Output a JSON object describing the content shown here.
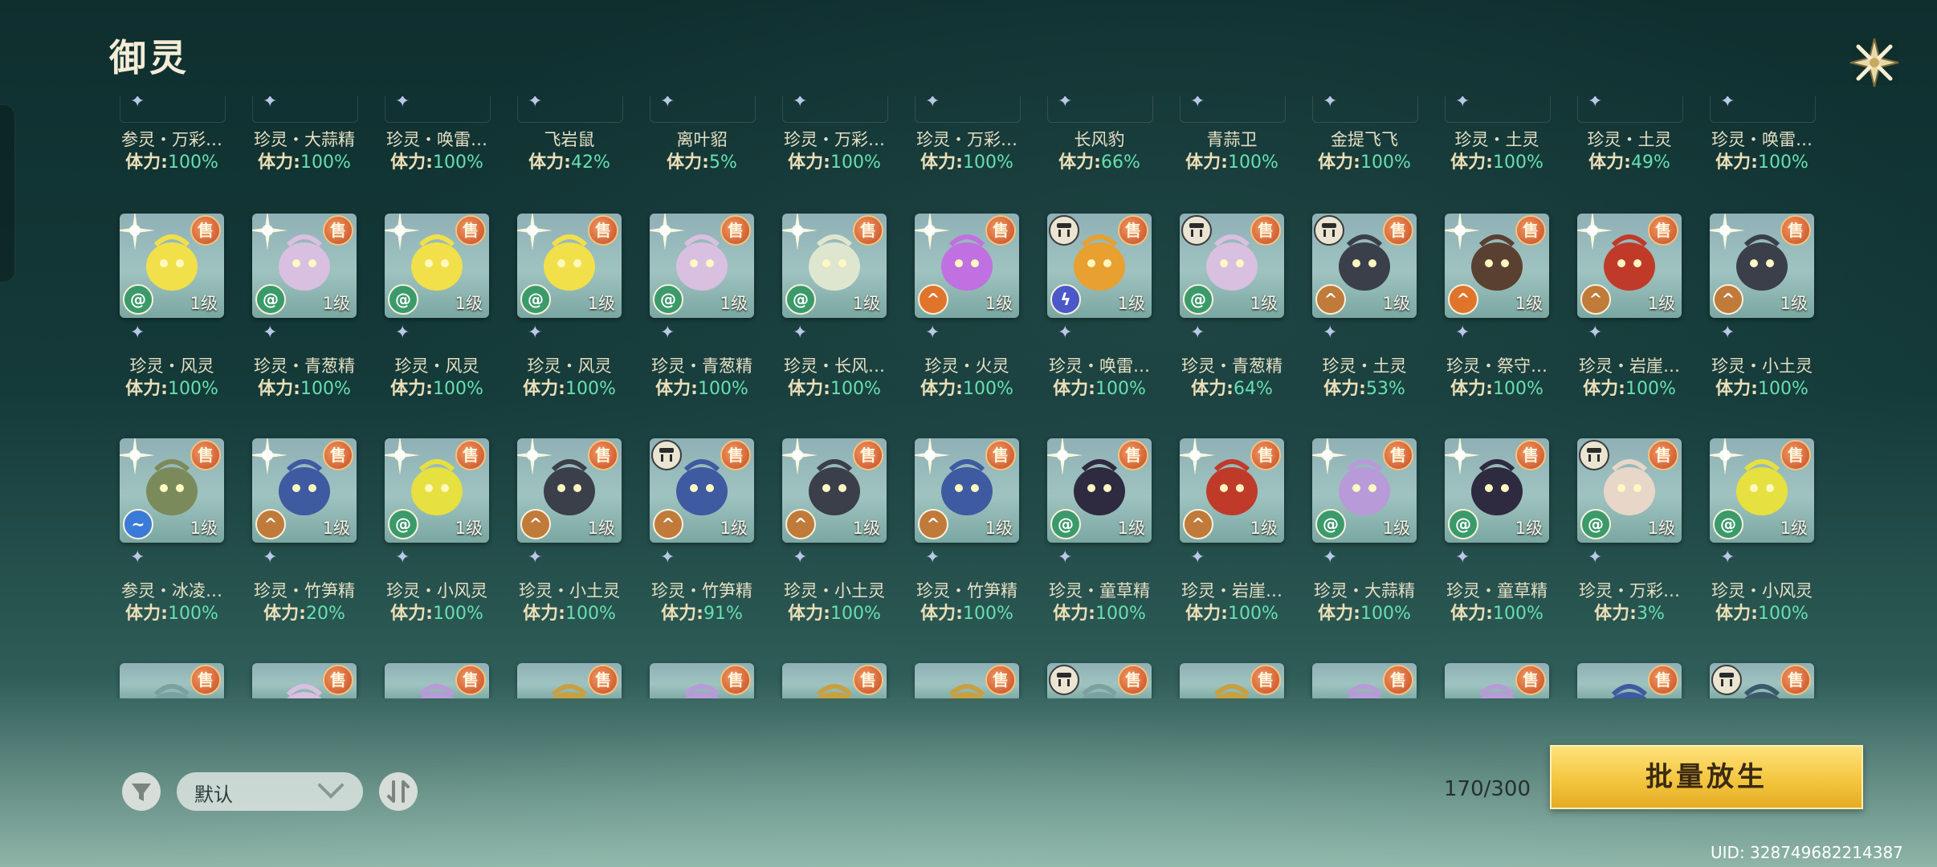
{
  "title": "御灵",
  "colors": {
    "stamina_pct": "#66e0b0",
    "sell_badge": "#d9562a",
    "batch_button": "#f4c640"
  },
  "level_label": "1级",
  "sell_label": "售",
  "row0": [
    {
      "name": "参灵・万彩…",
      "stamina": "100%"
    },
    {
      "name": "珍灵・大蒜精",
      "stamina": "100%"
    },
    {
      "name": "珍灵・唤雷…",
      "stamina": "100%"
    },
    {
      "name": "飞岩鼠",
      "stamina": "42%"
    },
    {
      "name": "离叶貂",
      "stamina": "5%"
    },
    {
      "name": "珍灵・万彩…",
      "stamina": "100%"
    },
    {
      "name": "珍灵・万彩…",
      "stamina": "100%"
    },
    {
      "name": "长风豹",
      "stamina": "66%"
    },
    {
      "name": "青蒜卫",
      "stamina": "100%"
    },
    {
      "name": "金提飞飞",
      "stamina": "100%"
    },
    {
      "name": "珍灵・土灵",
      "stamina": "100%"
    },
    {
      "name": "珍灵・土灵",
      "stamina": "49%"
    },
    {
      "name": "珍灵・唤雷…",
      "stamina": "100%"
    }
  ],
  "row1": [
    {
      "name": "珍灵・风灵",
      "stamina": "100%",
      "element": "wind-icon",
      "color": "#f2e04a",
      "locked": false,
      "spark": true
    },
    {
      "name": "珍灵・青葱精",
      "stamina": "100%",
      "element": "wind-icon",
      "color": "#d9bfe0",
      "locked": false,
      "spark": true
    },
    {
      "name": "珍灵・风灵",
      "stamina": "100%",
      "element": "wind-icon",
      "color": "#f2e04a",
      "locked": false,
      "spark": true
    },
    {
      "name": "珍灵・风灵",
      "stamina": "100%",
      "element": "wind-icon",
      "color": "#f2e04a",
      "locked": false,
      "spark": true
    },
    {
      "name": "珍灵・青葱精",
      "stamina": "100%",
      "element": "wind-icon",
      "color": "#d9bfe0",
      "locked": false,
      "spark": true
    },
    {
      "name": "珍灵・长风…",
      "stamina": "100%",
      "element": "wind-icon",
      "color": "#dfe6cf",
      "locked": false,
      "spark": true
    },
    {
      "name": "珍灵・火灵",
      "stamina": "100%",
      "element": "fire-icon",
      "color": "#c070e0",
      "locked": false,
      "spark": true
    },
    {
      "name": "珍灵・唤雷…",
      "stamina": "100%",
      "element": "thunder-icon",
      "color": "#e8a030",
      "locked": true,
      "spark": false
    },
    {
      "name": "珍灵・青葱精",
      "stamina": "64%",
      "element": "wind-icon",
      "color": "#d9bfe0",
      "locked": true,
      "spark": false
    },
    {
      "name": "珍灵・土灵",
      "stamina": "53%",
      "element": "earth-icon",
      "color": "#3a3f4a",
      "locked": true,
      "spark": false
    },
    {
      "name": "珍灵・祭守…",
      "stamina": "100%",
      "element": "fire-icon",
      "color": "#5a4030",
      "locked": false,
      "spark": true
    },
    {
      "name": "珍灵・岩崖…",
      "stamina": "100%",
      "element": "earth-icon",
      "color": "#c03a2a",
      "locked": false,
      "spark": true
    },
    {
      "name": "珍灵・小土灵",
      "stamina": "100%",
      "element": "earth-icon",
      "color": "#3a3f4a",
      "locked": false,
      "spark": true
    }
  ],
  "row2": [
    {
      "name": "参灵・冰凌…",
      "stamina": "100%",
      "element": "water-icon",
      "color": "#7b8a5a",
      "locked": false,
      "spark": true
    },
    {
      "name": "珍灵・竹笋精",
      "stamina": "20%",
      "element": "earth-icon",
      "color": "#3e5aa0",
      "locked": false,
      "spark": true
    },
    {
      "name": "珍灵・小风灵",
      "stamina": "100%",
      "element": "wind-icon",
      "color": "#e6e040",
      "locked": false,
      "spark": true
    },
    {
      "name": "珍灵・小土灵",
      "stamina": "100%",
      "element": "earth-icon",
      "color": "#3a3f4a",
      "locked": false,
      "spark": true
    },
    {
      "name": "珍灵・竹笋精",
      "stamina": "91%",
      "element": "earth-icon",
      "color": "#3e5aa0",
      "locked": true,
      "spark": false
    },
    {
      "name": "珍灵・小土灵",
      "stamina": "100%",
      "element": "earth-icon",
      "color": "#3a3f4a",
      "locked": false,
      "spark": true
    },
    {
      "name": "珍灵・竹笋精",
      "stamina": "100%",
      "element": "earth-icon",
      "color": "#3e5aa0",
      "locked": false,
      "spark": true
    },
    {
      "name": "珍灵・童草精",
      "stamina": "100%",
      "element": "wind-icon",
      "color": "#2e2a40",
      "locked": false,
      "spark": true
    },
    {
      "name": "珍灵・岩崖…",
      "stamina": "100%",
      "element": "earth-icon",
      "color": "#c03a2a",
      "locked": false,
      "spark": true
    },
    {
      "name": "珍灵・大蒜精",
      "stamina": "100%",
      "element": "wind-icon",
      "color": "#b89ad8",
      "locked": false,
      "spark": true
    },
    {
      "name": "珍灵・童草精",
      "stamina": "100%",
      "element": "wind-icon",
      "color": "#2e2a40",
      "locked": false,
      "spark": true
    },
    {
      "name": "珍灵・万彩…",
      "stamina": "3%",
      "element": "wind-icon",
      "color": "#e8d6c8",
      "locked": true,
      "spark": false
    },
    {
      "name": "珍灵・小风灵",
      "stamina": "100%",
      "element": "wind-icon",
      "color": "#e6e040",
      "locked": false,
      "spark": true
    }
  ],
  "row3": [
    {
      "locked": false,
      "color": "#7aa0a0"
    },
    {
      "locked": false,
      "color": "#d9bfe0"
    },
    {
      "locked": false,
      "color": "#b89ad8"
    },
    {
      "locked": false,
      "color": "#c8a040"
    },
    {
      "locked": false,
      "color": "#b89ad8"
    },
    {
      "locked": false,
      "color": "#c8a040"
    },
    {
      "locked": false,
      "color": "#c8a040"
    },
    {
      "locked": true,
      "color": "#7aa0a0"
    },
    {
      "locked": false,
      "color": "#c8a040"
    },
    {
      "locked": false,
      "color": "#b89ad8"
    },
    {
      "locked": false,
      "color": "#b89ad8"
    },
    {
      "locked": false,
      "color": "#3e5aa0"
    },
    {
      "locked": true,
      "color": "#3a5a6a"
    }
  ],
  "stamina_label": "体力:",
  "footer": {
    "sort_label": "默认",
    "count": "170/300",
    "batch_release_label": "批量放生",
    "uid": "UID: 328749682214387"
  }
}
